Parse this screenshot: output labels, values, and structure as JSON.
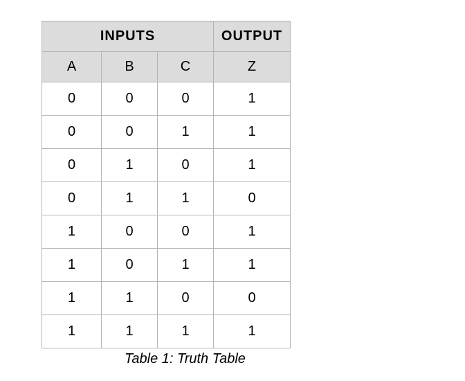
{
  "chart_data": {
    "type": "table",
    "caption": "Table 1: Truth Table",
    "header_groups": [
      {
        "label": "INPUTS",
        "span": 3
      },
      {
        "label": "OUTPUT",
        "span": 1
      }
    ],
    "columns": [
      "A",
      "B",
      "C",
      "Z"
    ],
    "rows": [
      {
        "A": "0",
        "B": "0",
        "C": "0",
        "Z": "1"
      },
      {
        "A": "0",
        "B": "0",
        "C": "1",
        "Z": "1"
      },
      {
        "A": "0",
        "B": "1",
        "C": "0",
        "Z": "1"
      },
      {
        "A": "0",
        "B": "1",
        "C": "1",
        "Z": "0"
      },
      {
        "A": "1",
        "B": "0",
        "C": "0",
        "Z": "1"
      },
      {
        "A": "1",
        "B": "0",
        "C": "1",
        "Z": "1"
      },
      {
        "A": "1",
        "B": "1",
        "C": "0",
        "Z": "0"
      },
      {
        "A": "1",
        "B": "1",
        "C": "1",
        "Z": "1"
      }
    ]
  }
}
